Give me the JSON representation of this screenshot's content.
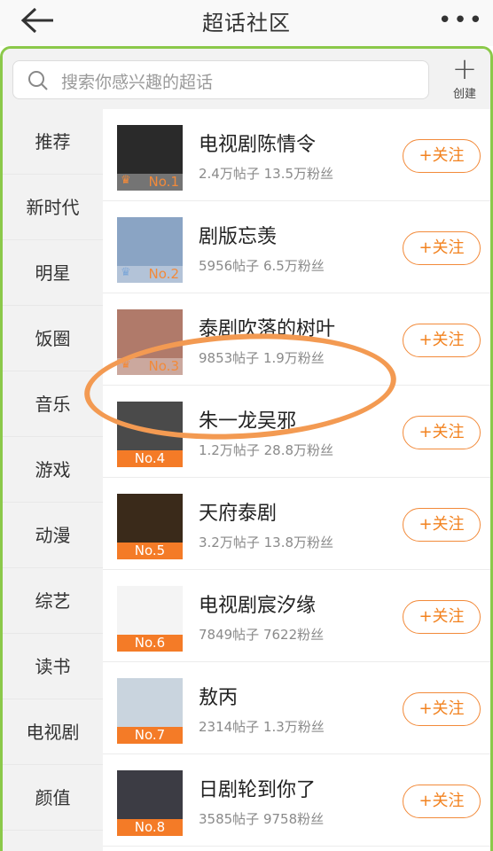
{
  "header": {
    "title": "超话社区",
    "more": "•••"
  },
  "search": {
    "placeholder": "搜索你感兴趣的超话",
    "create_label": "创建",
    "create_icon": "plus-icon"
  },
  "sidebar": {
    "items": [
      {
        "label": "推荐"
      },
      {
        "label": "新时代"
      },
      {
        "label": "明星"
      },
      {
        "label": "饭圈"
      },
      {
        "label": "音乐"
      },
      {
        "label": "游戏"
      },
      {
        "label": "动漫"
      },
      {
        "label": "综艺"
      },
      {
        "label": "读书"
      },
      {
        "label": "电视剧"
      },
      {
        "label": "颜值"
      }
    ]
  },
  "list": {
    "follow_label": "+关注",
    "items": [
      {
        "name": "电视剧陈情令",
        "stats": "2.4万帖子 13.5万粉丝",
        "rank": "No.1",
        "top3": true
      },
      {
        "name": "剧版忘羡",
        "stats": "5956帖子 6.5万粉丝",
        "rank": "No.2",
        "top3": true
      },
      {
        "name": "泰剧吹落的树叶",
        "stats": "9853帖子 1.9万粉丝",
        "rank": "No.3",
        "top3": true
      },
      {
        "name": "朱一龙吴邪",
        "stats": "1.2万帖子 28.8万粉丝",
        "rank": "No.4",
        "top3": false
      },
      {
        "name": "天府泰剧",
        "stats": "3.2万帖子 13.8万粉丝",
        "rank": "No.5",
        "top3": false
      },
      {
        "name": "电视剧宸汐缘",
        "stats": "7849帖子 7622粉丝",
        "rank": "No.6",
        "top3": false
      },
      {
        "name": "敖丙",
        "stats": "2314帖子 1.3万粉丝",
        "rank": "No.7",
        "top3": false
      },
      {
        "name": "日剧轮到你了",
        "stats": "3585帖子 9758粉丝",
        "rank": "No.8",
        "top3": false
      }
    ]
  },
  "colors": {
    "accent": "#f2821f",
    "frame": "#8bc94a",
    "annotation": "#f39a52"
  }
}
